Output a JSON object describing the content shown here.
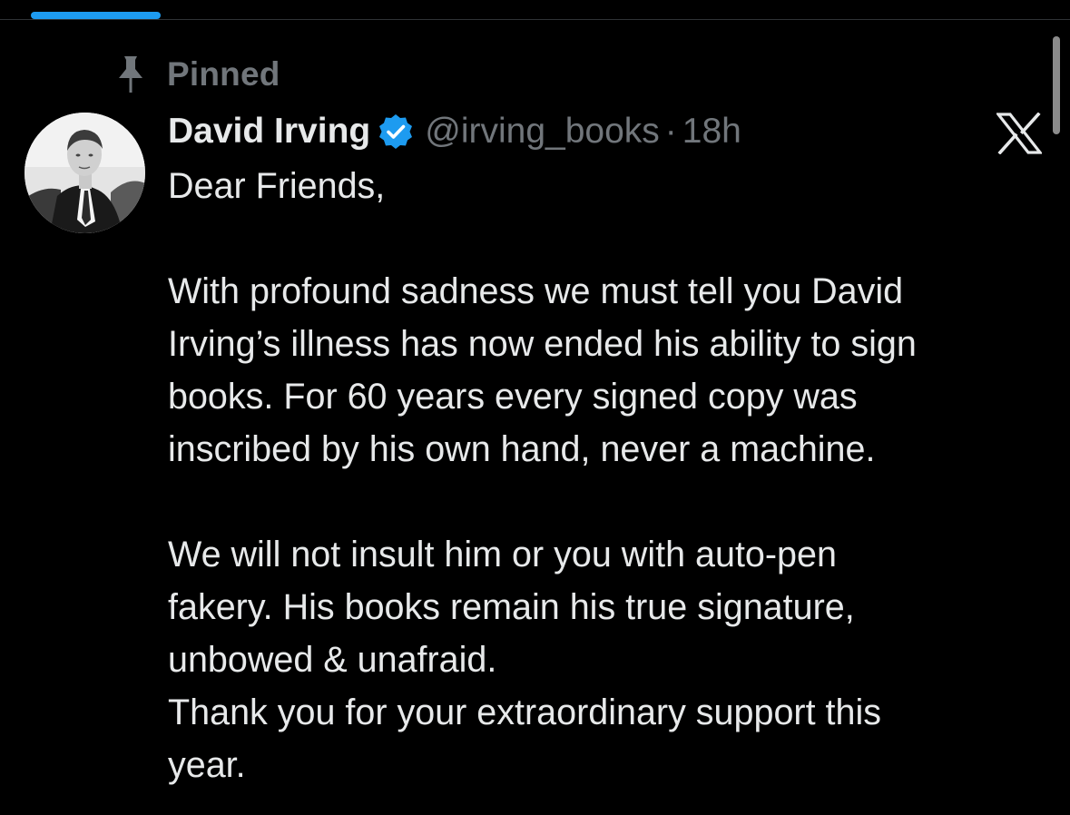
{
  "tab_bar": {
    "active_indicator_color": "#1d9bf0"
  },
  "post": {
    "pinned_label": "Pinned",
    "author": {
      "display_name": "David Irving",
      "handle": "@irving_books",
      "verified": true,
      "verified_color": "#1d9bf0"
    },
    "separator": "·",
    "time": "18h",
    "platform_icon": "x-logo-icon",
    "body": {
      "greeting": "Dear Friends,",
      "paragraph1_lines": [
        "With profound sadness we must tell you David",
        "Irving’s illness has now ended his ability to sign",
        "books. For 60 years every signed copy was",
        "inscribed by his own hand, never a machine."
      ],
      "paragraph2_lines": [
        "We will not insult him or you with auto-pen",
        "fakery. His books remain his true signature,",
        "unbowed & unafraid.",
        "Thank you for your extraordinary support this",
        "year."
      ]
    }
  },
  "colors": {
    "background": "#000000",
    "primary_text": "#e7e9ea",
    "secondary_text": "#71767b"
  }
}
